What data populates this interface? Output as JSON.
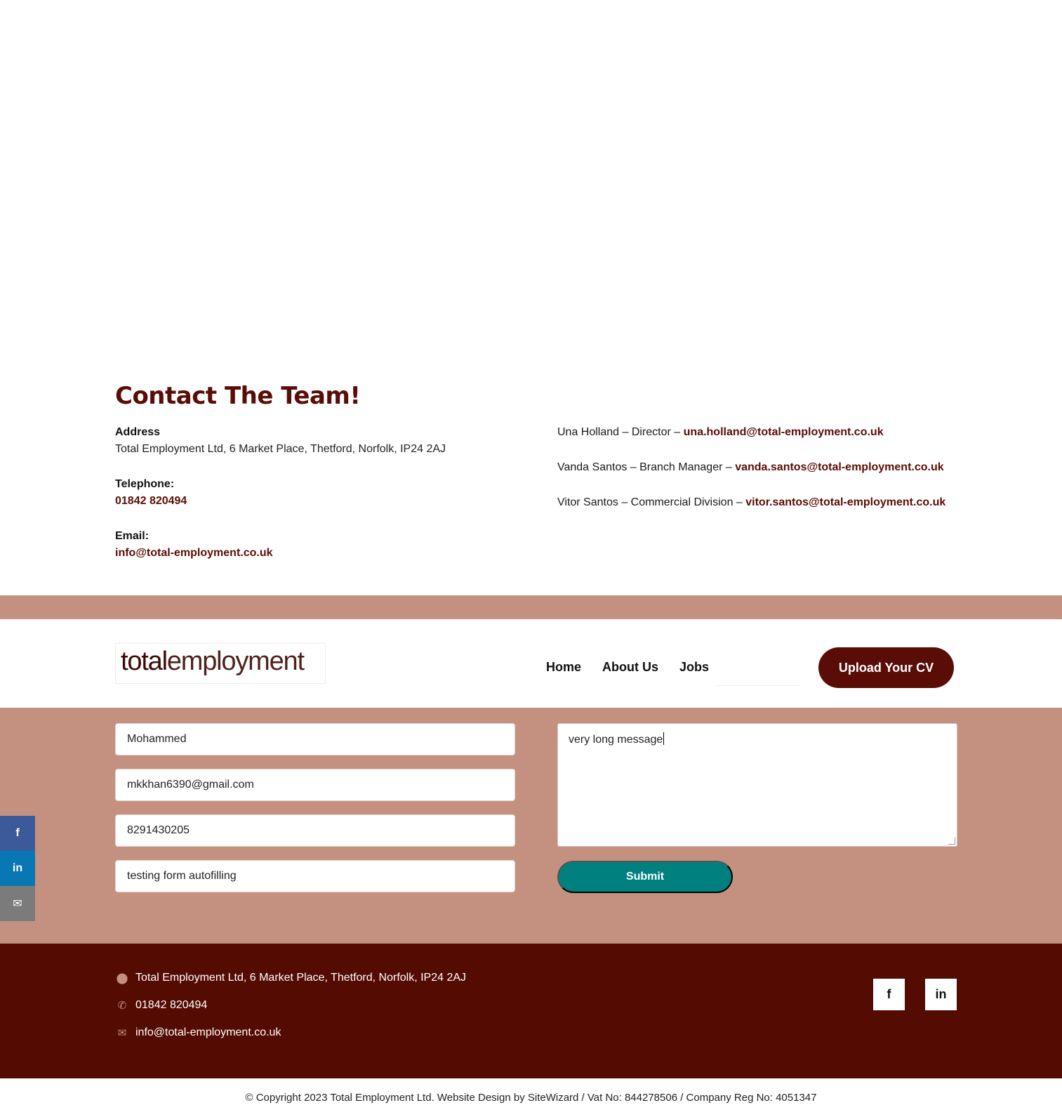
{
  "contact": {
    "title": "Contact The Team!",
    "address_label": "Address",
    "address_value": "Total Employment Ltd, 6 Market Place, Thetford, Norfolk, IP24 2AJ",
    "telephone_label": "Telephone:",
    "telephone_value": "01842 820494",
    "email_label": "Email:",
    "email_value": "info@total-employment.co.uk",
    "team": [
      {
        "text": "Una Holland – Director – ",
        "email": "una.holland@total-employment.co.uk"
      },
      {
        "text": "Vanda Santos – Branch Manager – ",
        "email": "vanda.santos@total-employment.co.uk"
      },
      {
        "text": "Vitor Santos – Commercial Division – ",
        "email": "vitor.santos@total-employment.co.uk"
      }
    ]
  },
  "header": {
    "logo_total": "total",
    "logo_employment": "employment",
    "nav": [
      "Home",
      "About Us",
      "Jobs"
    ],
    "upload_label": "Upload Your CV"
  },
  "form": {
    "name": "Mohammed",
    "email": "mkkhan6390@gmail.com",
    "phone": "8291430205",
    "subject": "testing form autofilling",
    "message": "very long message",
    "submit_label": "Submit"
  },
  "side_social": {
    "facebook_glyph": "f",
    "linkedin_glyph": "in",
    "email_glyph": "✉"
  },
  "footer": {
    "address": "Total Employment Ltd, 6 Market Place, Thetford, Norfolk, IP24 2AJ",
    "phone": "01842 820494",
    "email": "info@total-employment.co.uk",
    "facebook_glyph": "f",
    "linkedin_glyph": "in"
  },
  "copyright": "© Copyright 2023 Total Employment Ltd. Website Design by SiteWizard / Vat No: 844278506 / Company Reg No: 4051347",
  "colors": {
    "brand_dark": "#540b01",
    "brand_pink": "#c49180",
    "submit_teal": "#00807f"
  }
}
